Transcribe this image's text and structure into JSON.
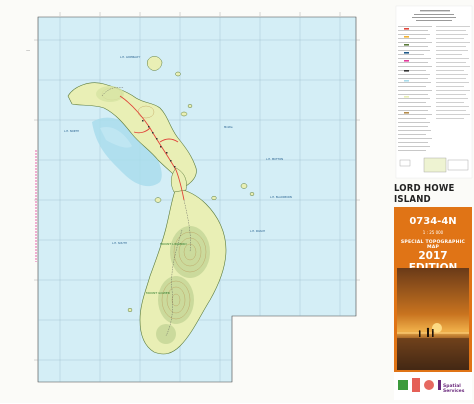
{
  "sheet": {
    "title": "LORD HOWE ISLAND",
    "map_code": "0734-4N",
    "scale": "1 : 25 000",
    "series": "SPECIAL TOPOGRAPHIC MAP",
    "edition": "2017 EDITION",
    "publisher": "Spatial Services"
  },
  "colors": {
    "sea": "#d4eef6",
    "land": "#e9efb5",
    "reef": "#a9dcec",
    "road": "#e0443a",
    "cover_orange": "#e07416",
    "publisher_purple": "#6b2a7d"
  }
}
